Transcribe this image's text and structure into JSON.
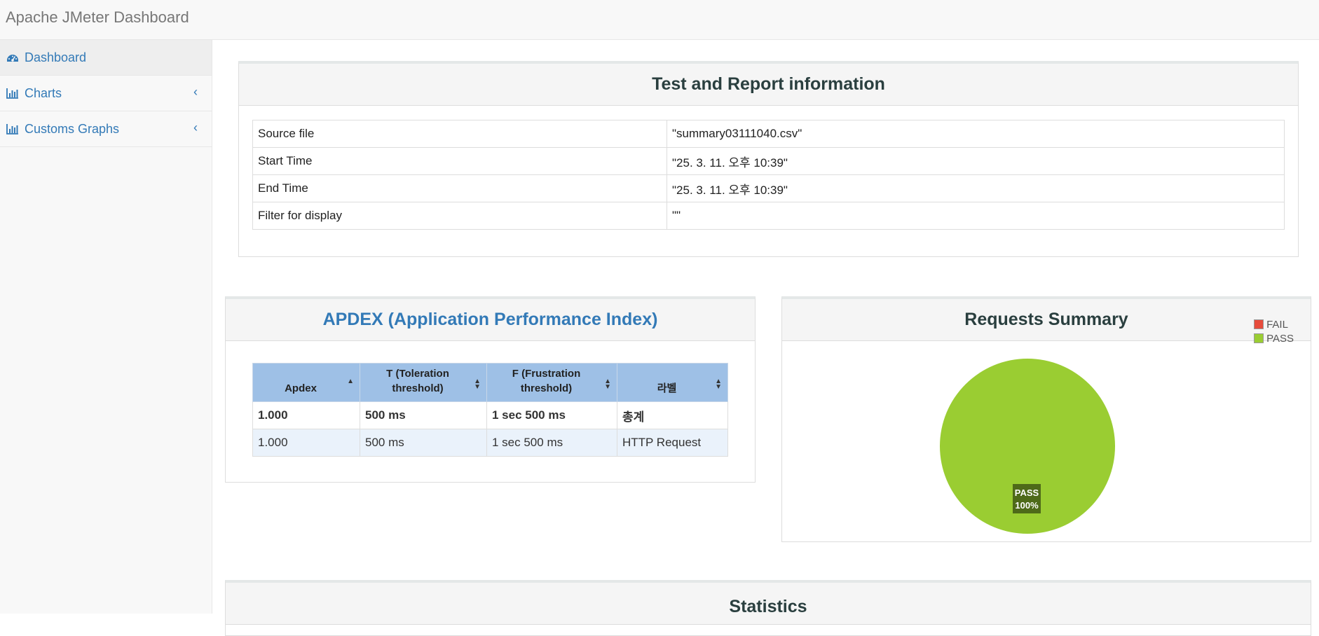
{
  "app": {
    "title": "Apache JMeter Dashboard"
  },
  "sidebar": {
    "items": [
      {
        "label": "Dashboard",
        "icon": "dashboard-icon",
        "active": true
      },
      {
        "label": "Charts",
        "icon": "bar-chart-icon",
        "expandable": true
      },
      {
        "label": "Customs Graphs",
        "icon": "bar-chart-icon",
        "expandable": true
      }
    ]
  },
  "test_info": {
    "title": "Test and Report information",
    "rows": [
      {
        "key": "Source file",
        "value": "\"summary03111040.csv\""
      },
      {
        "key": "Start Time",
        "value": "\"25. 3. 11. 오후 10:39\""
      },
      {
        "key": "End Time",
        "value": "\"25. 3. 11. 오후 10:39\""
      },
      {
        "key": "Filter for display",
        "value": "\"\""
      }
    ]
  },
  "apdex": {
    "title": "APDEX (Application Performance Index)",
    "headers": [
      "Apdex",
      "T (Toleration threshold)",
      "F (Frustration threshold)",
      "라벨"
    ],
    "total_row": [
      "1.000",
      "500 ms",
      "1 sec 500 ms",
      "총계"
    ],
    "rows": [
      [
        "1.000",
        "500 ms",
        "1 sec 500 ms",
        "HTTP Request"
      ]
    ]
  },
  "requests_summary": {
    "title": "Requests Summary",
    "legend": [
      {
        "label": "FAIL",
        "color": "#e74c3c"
      },
      {
        "label": "PASS",
        "color": "#9acd32"
      }
    ],
    "slice_label": "PASS",
    "slice_percent": "100%"
  },
  "statistics": {
    "title": "Statistics"
  },
  "chart_data": {
    "type": "pie",
    "title": "Requests Summary",
    "categories": [
      "FAIL",
      "PASS"
    ],
    "values": [
      0,
      100
    ],
    "colors": [
      "#e74c3c",
      "#9acd32"
    ],
    "legend_position": "top-right"
  }
}
